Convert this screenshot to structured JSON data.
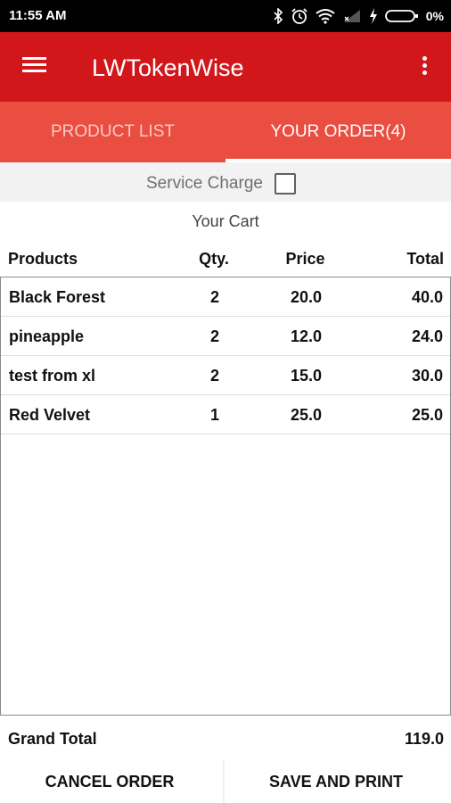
{
  "status_bar": {
    "time": "11:55 AM",
    "battery": "0%",
    "icons": [
      "bluetooth-icon",
      "alarm-icon",
      "wifi-icon",
      "signal-icon",
      "charging-icon",
      "battery-icon"
    ]
  },
  "app_bar": {
    "title": "LWTokenWise",
    "menu_icon": "hamburger-menu-icon",
    "overflow_icon": "overflow-menu-icon",
    "color": "#d2171b"
  },
  "tabs": [
    {
      "label": "PRODUCT LIST",
      "selected": false
    },
    {
      "label": "YOUR ORDER(4)",
      "selected": true
    }
  ],
  "service_charge": {
    "label": "Service Charge",
    "checked": false
  },
  "cart": {
    "title": "Your Cart",
    "columns": {
      "product": "Products",
      "qty": "Qty.",
      "price": "Price",
      "total": "Total"
    },
    "rows": [
      {
        "product": "Black Forest",
        "qty": "2",
        "price": "20.0",
        "total": "40.0"
      },
      {
        "product": "pineapple",
        "qty": "2",
        "price": "12.0",
        "total": "24.0"
      },
      {
        "product": "test from xl",
        "qty": "2",
        "price": "15.0",
        "total": "30.0"
      },
      {
        "product": "Red Velvet",
        "qty": "1",
        "price": "25.0",
        "total": "25.0"
      }
    ]
  },
  "grand_total": {
    "label": "Grand Total",
    "value": "119.0"
  },
  "actions": {
    "cancel_label": "CANCEL ORDER",
    "save_label": "SAVE AND PRINT"
  }
}
